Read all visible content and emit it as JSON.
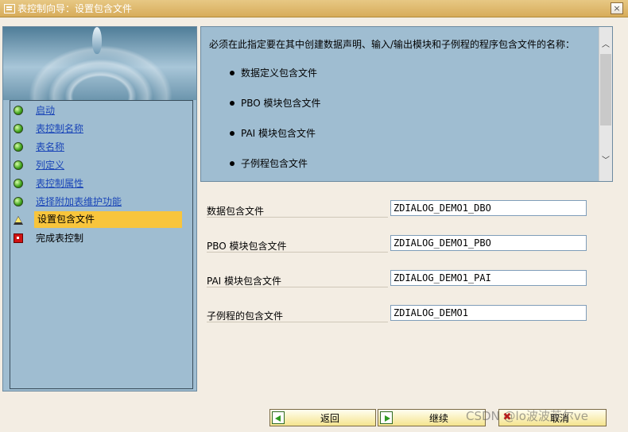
{
  "window": {
    "title": "表控制向导：设置包含文件",
    "close_symbol": "×"
  },
  "steps": [
    {
      "label": "启动",
      "status": "done",
      "icon": "green-dot-icon"
    },
    {
      "label": "表控制名称",
      "status": "done",
      "icon": "green-dot-icon"
    },
    {
      "label": "表名称",
      "status": "done",
      "icon": "green-dot-icon"
    },
    {
      "label": "列定义",
      "status": "done",
      "icon": "green-dot-icon"
    },
    {
      "label": "表控制属性",
      "status": "done",
      "icon": "green-dot-icon"
    },
    {
      "label": "选择附加表维护功能",
      "status": "done",
      "icon": "green-dot-icon"
    },
    {
      "label": "设置包含文件",
      "status": "current",
      "icon": "warning-triangle-icon"
    },
    {
      "label": "完成表控制",
      "status": "pending",
      "icon": "red-square-icon"
    }
  ],
  "info": {
    "text": "必须在此指定要在其中创建数据声明、输入/输出模块和子例程的程序包含文件的名称：",
    "items": [
      "数据定义包含文件",
      "PBO 模块包含文件",
      "PAI 模块包含文件",
      "子例程包含文件"
    ]
  },
  "fields": [
    {
      "label": "数据包含文件",
      "value": "ZDIALOG_DEMO1_DBO"
    },
    {
      "label": "PBO 模块包含文件",
      "value": "ZDIALOG_DEMO1_PBO"
    },
    {
      "label": "PAI 模块包含文件",
      "value": "ZDIALOG_DEMO1_PAI"
    },
    {
      "label": "子例程的包含文件",
      "value": "ZDIALOG_DEMO1"
    }
  ],
  "buttons": {
    "back": "返回",
    "continue": "继续",
    "cancel": "取消"
  },
  "watermark": "CSDN @lo波波莱尔ve",
  "colors": {
    "titlebar": "#d7ac5a",
    "panel": "#9fbdd1",
    "current_step": "#f8c53c",
    "link": "#1b46b8"
  }
}
